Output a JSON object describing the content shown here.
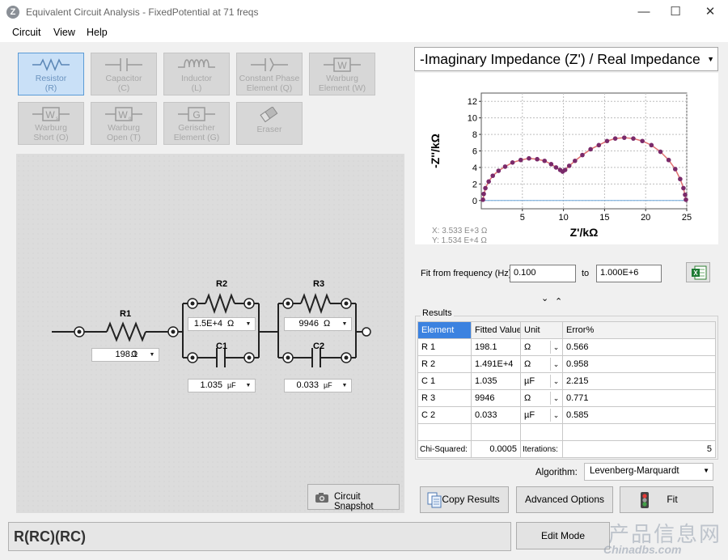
{
  "window": {
    "app_icon": "Z",
    "title": "Equivalent Circuit Analysis - FixedPotential at 71 freqs",
    "controls": [
      "minimize-icon",
      "maximize-icon",
      "close-icon"
    ]
  },
  "menu": [
    "Circuit",
    "View",
    "Help"
  ],
  "toolbox": [
    {
      "line1": "Resistor",
      "line2": "(R)",
      "icon": "resistor-icon",
      "active": true
    },
    {
      "line1": "Capacitor",
      "line2": "(C)",
      "icon": "capacitor-icon"
    },
    {
      "line1": "Inductor",
      "line2": "(L)",
      "icon": "inductor-icon"
    },
    {
      "line1": "Constant Phase",
      "line2": "Element (Q)",
      "icon": "cpe-icon"
    },
    {
      "line1": "Warburg",
      "line2": "Element (W)",
      "icon": "warburg-icon"
    },
    {
      "line1": "Warburg",
      "line2": "Short (O)",
      "icon": "warburg-short-icon"
    },
    {
      "line1": "Warburg",
      "line2": "Open (T)",
      "icon": "warburg-open-icon"
    },
    {
      "line1": "Gerischer",
      "line2": "Element (G)",
      "icon": "gerischer-icon"
    },
    {
      "line1": "Eraser",
      "line2": "",
      "icon": "eraser-icon"
    }
  ],
  "circuit": {
    "r1": {
      "label": "R1",
      "value": "198.1",
      "unit": "Ω"
    },
    "r2": {
      "label": "R2",
      "value": "1.5E+4",
      "unit": "Ω"
    },
    "c1": {
      "label": "C1",
      "value": "1.035",
      "unit": "µF"
    },
    "r3": {
      "label": "R3",
      "value": "9946",
      "unit": "Ω"
    },
    "c2": {
      "label": "C2",
      "value": "0.033",
      "unit": "µF"
    },
    "snapshot_label": "Circuit Snapshot",
    "string": "R(RC)(RC)",
    "edit_mode_label": "Edit Mode"
  },
  "plot": {
    "selector": "-Imaginary Impedance (Z') / Real Impedance",
    "cursor_x": "X: 3.533 E+3 Ω",
    "cursor_y": "Y: 1.534 E+4 Ω"
  },
  "chart_data": {
    "type": "scatter",
    "xlabel": "Z'/kΩ",
    "ylabel": "-Z''/kΩ",
    "xlim": [
      0,
      25
    ],
    "ylim": [
      -1,
      13
    ],
    "xticks": [
      5,
      10,
      15,
      20,
      25
    ],
    "yticks": [
      0,
      2,
      4,
      6,
      8,
      10,
      12
    ],
    "grid": true,
    "series": [
      {
        "color": "#7a2a6a",
        "x": [
          0.2,
          0.3,
          0.5,
          0.9,
          1.4,
          2.1,
          2.9,
          3.8,
          4.8,
          5.8,
          6.8,
          7.7,
          8.5,
          9.1,
          9.6,
          9.9,
          10.2,
          10.7,
          11.4,
          12.3,
          13.3,
          14.3,
          15.3,
          16.3,
          17.4,
          18.5,
          19.6,
          20.7,
          21.8,
          22.8,
          23.6,
          24.2,
          24.6,
          24.8,
          24.9
        ],
        "y": [
          0.1,
          0.8,
          1.5,
          2.3,
          3.0,
          3.6,
          4.1,
          4.6,
          4.9,
          5.1,
          5.0,
          4.8,
          4.4,
          4.0,
          3.7,
          3.5,
          3.7,
          4.2,
          4.8,
          5.5,
          6.2,
          6.7,
          7.2,
          7.5,
          7.6,
          7.5,
          7.2,
          6.7,
          5.9,
          4.9,
          3.8,
          2.6,
          1.5,
          0.7,
          0.1
        ]
      },
      {
        "color": "#e07070",
        "x": [
          0.2,
          0.5,
          0.9,
          1.4,
          2.1,
          2.9,
          3.8,
          4.8,
          5.8,
          6.8,
          7.7,
          8.5,
          9.1,
          9.6,
          9.9,
          10.2,
          10.7,
          11.4,
          12.3,
          13.3,
          14.3,
          15.3,
          16.3,
          17.4,
          18.5,
          19.6,
          20.7,
          21.8,
          22.8,
          23.6,
          24.2,
          24.6,
          24.9
        ],
        "y": [
          0.1,
          1.5,
          2.3,
          3.0,
          3.6,
          4.1,
          4.6,
          4.9,
          5.1,
          5.0,
          4.8,
          4.4,
          4.0,
          3.7,
          3.5,
          3.7,
          4.2,
          4.8,
          5.5,
          6.2,
          6.7,
          7.2,
          7.5,
          7.6,
          7.5,
          7.2,
          6.7,
          5.9,
          4.9,
          3.8,
          2.6,
          1.5,
          0.1
        ]
      }
    ]
  },
  "fit_range": {
    "label": "Fit from frequency (Hz):",
    "from": "0.100",
    "to_label": "to",
    "to": "1.000E+6"
  },
  "results": {
    "group_title": "Results",
    "headers": [
      "Element",
      "Fitted Value",
      "Unit",
      "Error%"
    ],
    "rows": [
      {
        "element": "R 1",
        "value": "198.1",
        "unit": "Ω",
        "error": "0.566"
      },
      {
        "element": "R 2",
        "value": "1.491E+4",
        "unit": "Ω",
        "error": "0.958"
      },
      {
        "element": "C 1",
        "value": "1.035",
        "unit": "µF",
        "error": "2.215"
      },
      {
        "element": "R 3",
        "value": "9946",
        "unit": "Ω",
        "error": "0.771"
      },
      {
        "element": "C 2",
        "value": "0.033",
        "unit": "µF",
        "error": "0.585"
      }
    ],
    "chi_label": "Chi-Squared:",
    "chi_value": "0.0005",
    "iter_label": "Iterations:",
    "iter_value": "5"
  },
  "algorithm": {
    "label": "Algorithm:",
    "value": "Levenberg-Marquardt"
  },
  "actions": {
    "copy": "Copy Results",
    "advanced": "Advanced Options",
    "fit": "Fit"
  },
  "watermark": {
    "line1": "产品信息网",
    "line2": "Chinadbs.com"
  }
}
